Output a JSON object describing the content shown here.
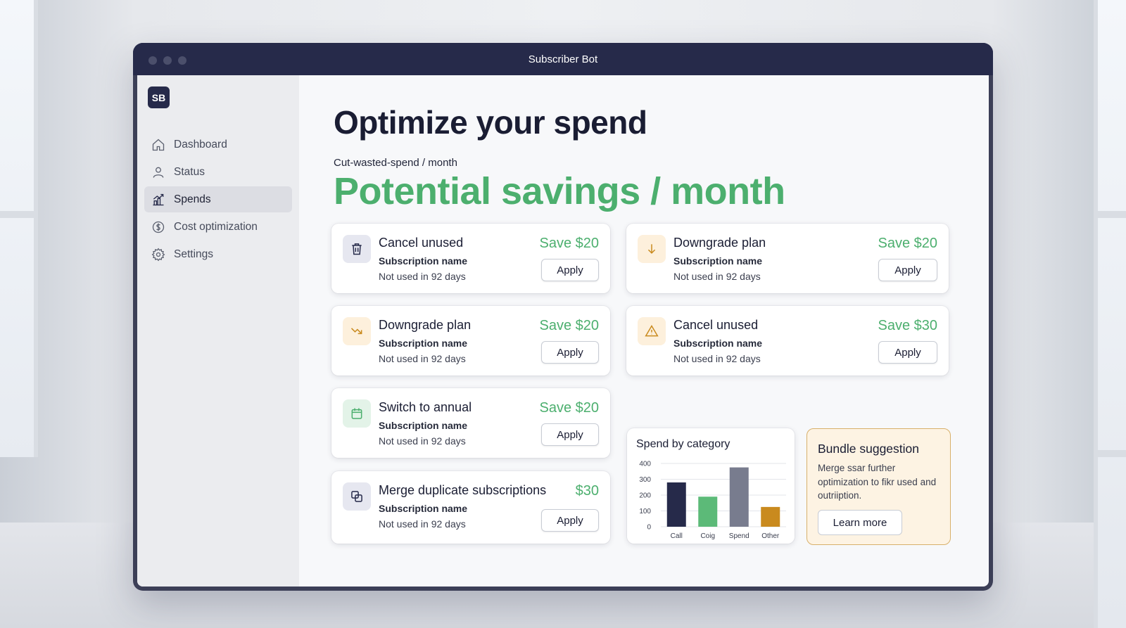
{
  "window": {
    "title": "Subscriber Bot"
  },
  "sidebar": {
    "logo": "SB",
    "items": [
      {
        "label": "Dashboard",
        "icon": "home-icon"
      },
      {
        "label": "Status",
        "icon": "user-icon"
      },
      {
        "label": "Spends",
        "icon": "chart-icon",
        "active": true
      },
      {
        "label": "Cost optimization",
        "icon": "dollar-icon"
      },
      {
        "label": "Settings",
        "icon": "gear-icon"
      }
    ]
  },
  "main": {
    "title": "Optimize your spend",
    "subtitle": "Cut-wasted-spend / month",
    "headline": "Potential savings / month"
  },
  "cards": [
    {
      "title": "Cancel unused",
      "subscription": "Subscription name",
      "usage": "Not used in 92 days",
      "save": "Save $20",
      "apply": "Apply",
      "icon": "trash-icon"
    },
    {
      "title": "Downgrade plan",
      "subscription": "Subscription name",
      "usage": "Not used in 92 days",
      "save": "Save $20",
      "apply": "Apply",
      "icon": "arrow-down-icon"
    },
    {
      "title": "Downgrade plan",
      "subscription": "Subscription name",
      "usage": "Not used in 92 days",
      "save": "Save $20",
      "apply": "Apply",
      "icon": "trend-down-icon"
    },
    {
      "title": "Cancel unused",
      "subscription": "Subscription name",
      "usage": "Not used in 92 days",
      "save": "Save $30",
      "apply": "Apply",
      "icon": "warning-icon"
    },
    {
      "title": "Switch to annual",
      "subscription": "Subscription name",
      "usage": "Not used in 92 days",
      "save": "Save $20",
      "apply": "Apply",
      "icon": "calendar-icon"
    },
    {
      "title": "Merge duplicate subscriptions",
      "subscription": "Subscription name",
      "usage": "Not used in 92 days",
      "save": "$30",
      "apply": "Apply",
      "icon": "merge-icon"
    }
  ],
  "chart_data": {
    "type": "bar",
    "title": "Spend by category",
    "categories": [
      "Call",
      "Coig",
      "Spend",
      "Other"
    ],
    "values": [
      280,
      190,
      375,
      125
    ],
    "colors": [
      "#262a4a",
      "#5cba78",
      "#787c8e",
      "#c98a1e"
    ],
    "yticks": [
      0,
      100,
      200,
      300,
      400
    ],
    "ylim": [
      0,
      400
    ]
  },
  "bundle": {
    "title": "Bundle suggestion",
    "text": "Merge ssar further optimization to fikr used and outriiption.",
    "button": "Learn more"
  },
  "colors": {
    "accent_green": "#4caf6e",
    "navy": "#262a4a"
  }
}
